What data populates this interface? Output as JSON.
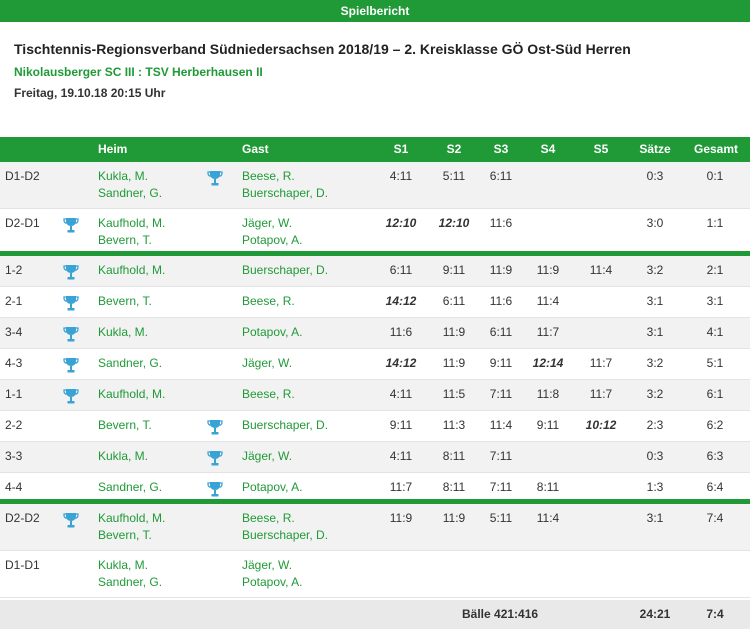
{
  "title_bar": "Spielbericht",
  "league": "Tischtennis-Regionsverband Südniedersachsen 2018/19 – 2. Kreisklasse GÖ Ost-Süd Herren",
  "teams": "Nikolausberger SC III : TSV Herberhausen II",
  "date": "Freitag, 19.10.18 20:15 Uhr",
  "columns": {
    "home": "Heim",
    "guest": "Gast",
    "s1": "S1",
    "s2": "S2",
    "s3": "S3",
    "s4": "S4",
    "s5": "S5",
    "saetze": "Sätze",
    "gesamt": "Gesamt"
  },
  "colors": {
    "accent": "#1f9a37",
    "trophy": "#3aa3d6"
  },
  "matches": [
    {
      "label": "D1-D2",
      "home": [
        "Kukla, M.",
        "Sandner, G."
      ],
      "guest": [
        "Beese, R.",
        "Buerschaper, D."
      ],
      "winner": "guest",
      "sets": [
        "4:11",
        "5:11",
        "6:11",
        "",
        ""
      ],
      "bold": [],
      "saetze": "0:3",
      "gesamt": "0:1",
      "double": true,
      "sep": false
    },
    {
      "label": "D2-D1",
      "home": [
        "Kaufhold, M.",
        "Bevern, T."
      ],
      "guest": [
        "Jäger, W.",
        "Potapov, A."
      ],
      "winner": "home",
      "sets": [
        "12:10",
        "12:10",
        "11:6",
        "",
        ""
      ],
      "bold": [
        0,
        1
      ],
      "saetze": "3:0",
      "gesamt": "1:1",
      "double": true,
      "sep": true
    },
    {
      "label": "1-2",
      "home": [
        "Kaufhold, M."
      ],
      "guest": [
        "Buerschaper, D."
      ],
      "winner": "home",
      "sets": [
        "6:11",
        "9:11",
        "11:9",
        "11:9",
        "11:4"
      ],
      "bold": [],
      "saetze": "3:2",
      "gesamt": "2:1",
      "double": false,
      "sep": false
    },
    {
      "label": "2-1",
      "home": [
        "Bevern, T."
      ],
      "guest": [
        "Beese, R."
      ],
      "winner": "home",
      "sets": [
        "14:12",
        "6:11",
        "11:6",
        "11:4",
        ""
      ],
      "bold": [
        0
      ],
      "saetze": "3:1",
      "gesamt": "3:1",
      "double": false,
      "sep": false
    },
    {
      "label": "3-4",
      "home": [
        "Kukla, M."
      ],
      "guest": [
        "Potapov, A."
      ],
      "winner": "home",
      "sets": [
        "11:6",
        "11:9",
        "6:11",
        "11:7",
        ""
      ],
      "bold": [],
      "saetze": "3:1",
      "gesamt": "4:1",
      "double": false,
      "sep": false
    },
    {
      "label": "4-3",
      "home": [
        "Sandner, G."
      ],
      "guest": [
        "Jäger, W."
      ],
      "winner": "home",
      "sets": [
        "14:12",
        "11:9",
        "9:11",
        "12:14",
        "11:7"
      ],
      "bold": [
        0,
        3
      ],
      "saetze": "3:2",
      "gesamt": "5:1",
      "double": false,
      "sep": false
    },
    {
      "label": "1-1",
      "home": [
        "Kaufhold, M."
      ],
      "guest": [
        "Beese, R."
      ],
      "winner": "home",
      "sets": [
        "4:11",
        "11:5",
        "7:11",
        "11:8",
        "11:7"
      ],
      "bold": [],
      "saetze": "3:2",
      "gesamt": "6:1",
      "double": false,
      "sep": false
    },
    {
      "label": "2-2",
      "home": [
        "Bevern, T."
      ],
      "guest": [
        "Buerschaper, D."
      ],
      "winner": "guest",
      "sets": [
        "9:11",
        "11:3",
        "11:4",
        "9:11",
        "10:12"
      ],
      "bold": [
        4
      ],
      "saetze": "2:3",
      "gesamt": "6:2",
      "double": false,
      "sep": false
    },
    {
      "label": "3-3",
      "home": [
        "Kukla, M."
      ],
      "guest": [
        "Jäger, W."
      ],
      "winner": "guest",
      "sets": [
        "4:11",
        "8:11",
        "7:11",
        "",
        ""
      ],
      "bold": [],
      "saetze": "0:3",
      "gesamt": "6:3",
      "double": false,
      "sep": false
    },
    {
      "label": "4-4",
      "home": [
        "Sandner, G."
      ],
      "guest": [
        "Potapov, A."
      ],
      "winner": "guest",
      "sets": [
        "11:7",
        "8:11",
        "7:11",
        "8:11",
        ""
      ],
      "bold": [],
      "saetze": "1:3",
      "gesamt": "6:4",
      "double": false,
      "sep": true
    },
    {
      "label": "D2-D2",
      "home": [
        "Kaufhold, M.",
        "Bevern, T."
      ],
      "guest": [
        "Beese, R.",
        "Buerschaper, D."
      ],
      "winner": "home",
      "sets": [
        "11:9",
        "11:9",
        "5:11",
        "11:4",
        ""
      ],
      "bold": [],
      "saetze": "3:1",
      "gesamt": "7:4",
      "double": true,
      "sep": false
    },
    {
      "label": "D1-D1",
      "home": [
        "Kukla, M.",
        "Sandner, G."
      ],
      "guest": [
        "Jäger, W.",
        "Potapov, A."
      ],
      "winner": "",
      "sets": [
        "",
        "",
        "",
        "",
        ""
      ],
      "bold": [],
      "saetze": "",
      "gesamt": "",
      "double": true,
      "sep": false
    }
  ],
  "footer": {
    "baelle": "Bälle 421:416",
    "saetze": "24:21",
    "gesamt": "7:4"
  }
}
